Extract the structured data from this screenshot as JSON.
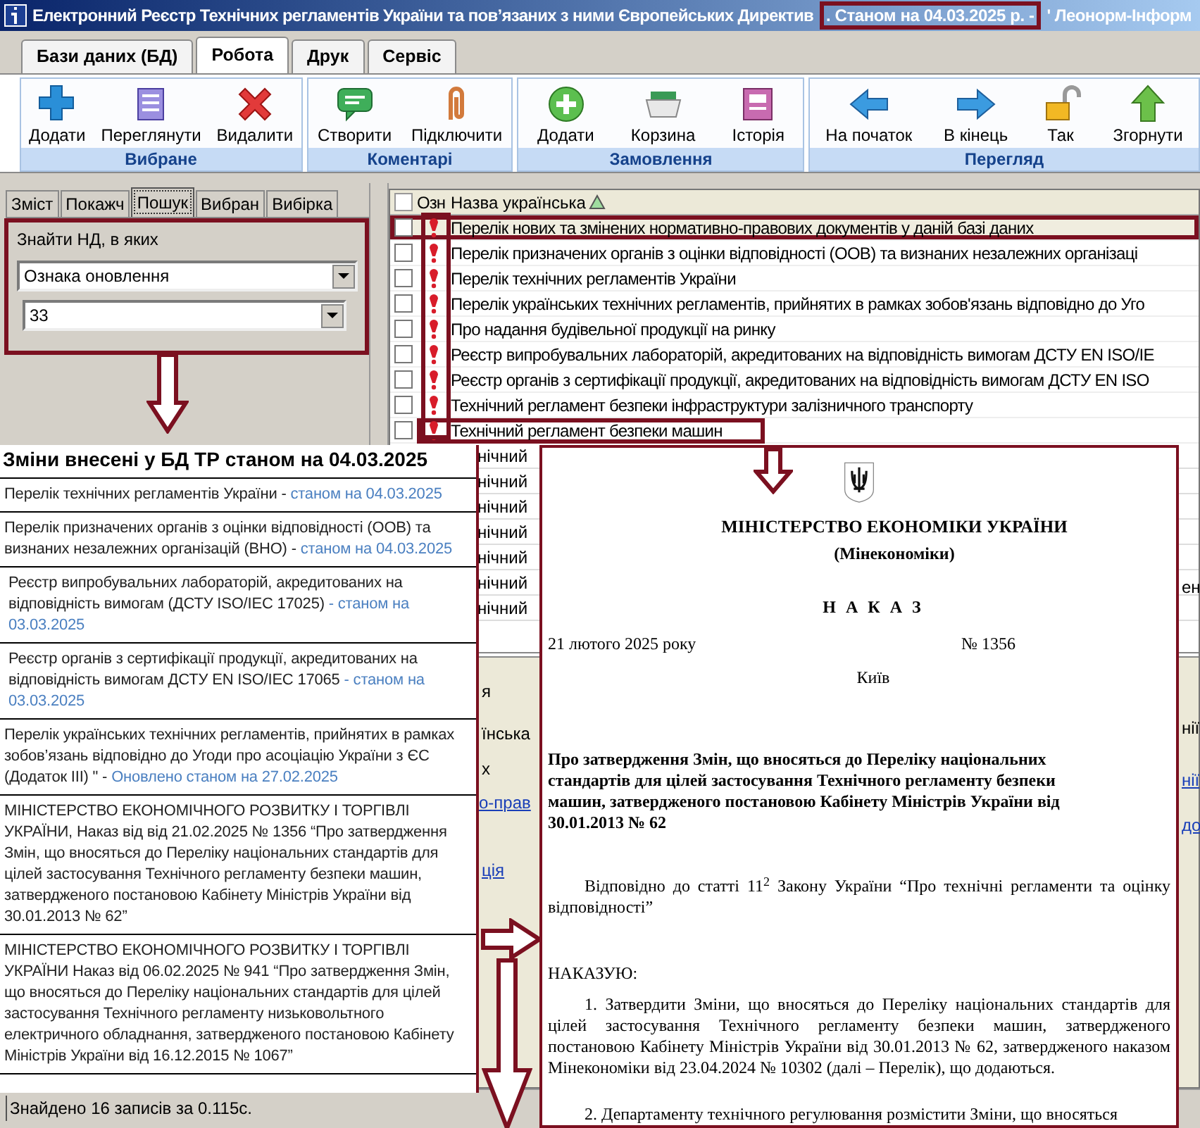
{
  "window": {
    "title": "Електронний Реєстр Технічних регламентів України та пов’язаних з ними Європейських Директив",
    "title_highlight": ". Станом на 04.03.2025 р. -",
    "title_tail": "' Леонорм-Інформ"
  },
  "menu_tabs": [
    {
      "label": "Бази даних (БД)",
      "selected": false
    },
    {
      "label": "Робота",
      "selected": true
    },
    {
      "label": "Друк",
      "selected": false
    },
    {
      "label": "Сервіс",
      "selected": false
    }
  ],
  "ribbon_groups": [
    {
      "label": "Вибране",
      "buttons": [
        {
          "label": "Додати",
          "kind": "plus"
        },
        {
          "label": "Переглянути",
          "kind": "notepad"
        },
        {
          "label": "Видалити",
          "kind": "cross"
        }
      ]
    },
    {
      "label": "Коментарі",
      "buttons": [
        {
          "label": "Створити",
          "kind": "comment"
        },
        {
          "label": "Підключити",
          "kind": "clip"
        }
      ]
    },
    {
      "label": "Замовлення",
      "buttons": [
        {
          "label": "Додати",
          "kind": "circleplus"
        },
        {
          "label": "Корзина",
          "kind": "basket"
        },
        {
          "label": "Історія",
          "kind": "history"
        }
      ]
    },
    {
      "label": "Перегляд",
      "buttons": [
        {
          "label": "На початок",
          "kind": "left"
        },
        {
          "label": "В кінець",
          "kind": "right"
        },
        {
          "label": "Так",
          "kind": "lock"
        },
        {
          "label": "Згорнути",
          "kind": "up"
        }
      ]
    }
  ],
  "left_tabs": [
    {
      "label": "Зміст",
      "selected": false
    },
    {
      "label": "Покажч",
      "selected": false
    },
    {
      "label": "Пошук",
      "selected": true
    },
    {
      "label": "Вибран",
      "selected": false
    },
    {
      "label": "Вибірка",
      "selected": false
    }
  ],
  "search": {
    "label": "Знайти НД, в яких",
    "field_1": "Ознака оновлення",
    "field_2": "33"
  },
  "list": {
    "columns": [
      "Озн",
      "Назва українська"
    ],
    "header_checked": false,
    "rows": [
      {
        "title": "Перелік нових та змінених нормативно-правових документів у даній базі даних",
        "selected": true,
        "checked": false,
        "annotated": true
      },
      {
        "title": "Перелік призначених органів з оцінки відповідності (ООВ) та визнаних незалежних організаці",
        "selected": false,
        "checked": false
      },
      {
        "title": "Перелік технічних регламентів України",
        "selected": false,
        "checked": false
      },
      {
        "title": "Перелік українських технічних регламентів, прийнятих в рамках зобов'язань відповідно до Уго",
        "selected": false,
        "checked": false
      },
      {
        "title": "Про надання будівельної продукції на ринку",
        "selected": false,
        "checked": false
      },
      {
        "title": "Реєстр випробувальних лабораторій, акредитованих на відповідність вимогам ДСТУ EN ISO/IE",
        "selected": false,
        "checked": false
      },
      {
        "title": "Реєстр органів з сертифікації продукції, акредитованих на відповідність вимогам ДСТУ EN ISO",
        "selected": false,
        "checked": false
      },
      {
        "title": "Технічний регламент безпеки інфраструктури залізничного транспорту",
        "selected": false,
        "checked": false
      },
      {
        "title": "Технічний регламент безпеки машин",
        "selected": false,
        "checked": false,
        "annotated": true
      }
    ],
    "partial_rows": [
      "нічний",
      "нічний",
      "нічний",
      "нічний",
      "нічний",
      "нічний",
      "нічний"
    ]
  },
  "background_fragments": [
    {
      "text": "ен",
      "kind": "text"
    },
    {
      "text": "я",
      "kind": "text"
    },
    {
      "text": "їнська",
      "kind": "text"
    },
    {
      "text": "нії",
      "kind": "text"
    },
    {
      "text": "х",
      "kind": "text"
    },
    {
      "text": "нії",
      "kind": "link"
    },
    {
      "text": "о-прав",
      "kind": "link"
    },
    {
      "text": "до",
      "kind": "link"
    },
    {
      "text": "ція",
      "kind": "link"
    }
  ],
  "changes_popup": {
    "heading": "Зміни внесені у БД ТР станом на 04.03.2025",
    "items": [
      {
        "text": "Перелік технічних регламентів України - ",
        "note": "станом на 04.03.2025"
      },
      {
        "text": "Перелік призначених органів з оцінки відповідності (ООВ) та визнаних незалежних організацій (ВНО) - ",
        "note": "станом на 04.03.2025"
      },
      {
        "text": "Реєстр випробувальних  лабораторій, акредитованих на відповідність вимогам (ДСТУ ISO/IEC 17025) ",
        "note": "- станом на 03.03.2025"
      },
      {
        "text": "Реєстр органів з сертифікації продукції, акредитованих на відповідність вимогам ДСТУ EN ISO/IEC 17065  ",
        "note": "- станом на 03.03.2025"
      },
      {
        "text": "Перелік українських технічних регламентів, прийнятих в рамках зобов’язань відповідно до Угоди про асоціацію України з ЄС (Додаток III) \" - ",
        "note": "Оновлено станом на 27.02.2025"
      },
      {
        "text": "МІНІСТЕРСТВО ЕКОНОМІЧНОГО РОЗВИТКУ І ТОРГІВЛІ УКРАЇНИ, Наказ від від 21.02.2025 № 1356 “Про затвердження Змін, що вносяться до Переліку національних стандартів для цілей застосування Технічного регламенту безпеки машин, затвердженого постановою Кабінету Міністрів України від 30.01.2013 № 62”"
      },
      {
        "text": "МІНІСТЕРСТВО ЕКОНОМІЧНОГО РОЗВИТКУ І ТОРГІВЛІ УКРАЇНИ Наказ від 06.02.2025 № 941 “Про затвердження Змін, що вносяться до Переліку національних стандартів для цілей застосування Технічного регламенту низьковольтного електричного обладнання, затвердженого постановою Кабінету Міністрів України від 16.12.2015 № 1067”"
      }
    ]
  },
  "document": {
    "ministry": "МІНІСТЕРСТВО ЕКОНОМІКИ УКРАЇНИ",
    "ministry_short": "(Мінекономіки)",
    "doc_type": "Н А К А З",
    "date": "21 лютого 2025 року",
    "number": "№ 1356",
    "city": "Київ",
    "title": "Про затвердження Змін, що вносяться до Переліку національних стандартів для цілей застосування Технічного регламенту безпеки машин, затвердженого постановою Кабінету Міністрів України від 30.01.2013 № 62",
    "preamble": "Відповідно до статті 11$^{2}$ Закону України “Про технічні регламенти та оцінку відповідності”",
    "order_word": "НАКАЗУЮ:",
    "clauses": [
      "1. Затвердити Зміни, що вносяться до Переліку національних стандартів для цілей застосування Технічного регламенту безпеки машин, затвердженого постановою Кабінету Міністрів України від 30.01.2013 № 62, затвердженого наказом Мінекономіки від 23.04.2024 № 10302 (далі – Перелік), що додаються.",
      "2. Департаменту технічного регулювання розмістити Зміни, що вносяться"
    ]
  },
  "status_bar": {
    "text": "Знайдено 16 записів за 0.115с."
  }
}
